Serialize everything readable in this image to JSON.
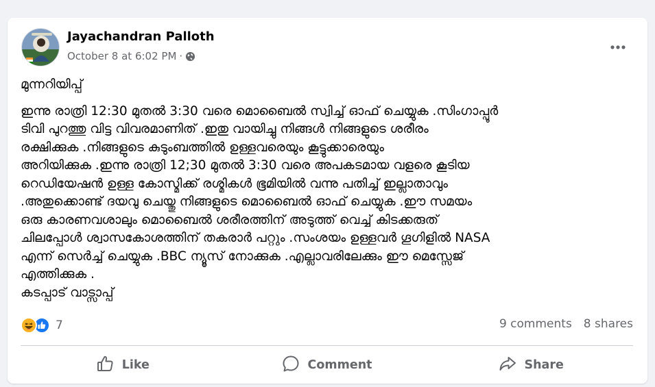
{
  "post": {
    "author": "Jayachandran Palloth",
    "timestamp": "October 8 at 6:02 PM",
    "separator": "·",
    "audience_icon": "globe-icon",
    "more_icon": "more-options-icon",
    "title": "മുന്നറിയിപ്പ്",
    "body_lines": [
      "ഇന്നു രാത്രി 12:30 മുതൽ 3:30 വരെ മൊബൈൽ സ്വിച്ച് ഓഫ് ചെയ്യുക .സിംഗാപ്പൂർ",
      "ടിവി പുറത്തു വിട്ട വിവരമാണിത് .ഇതു വായിച്ചു നിങ്ങൾ നിങ്ങളുടെ ശരീരം",
      "രക്ഷിക്കുക .നിങ്ങളുടെ കുടുംബത്തിൽ ഉള്ളവരെയും കൂട്ടുക്കാരെയും",
      "അറിയിക്കുക .ഇന്നു രാത്രി 12;30 മുതൽ 3:30 വരെ അപകടമായ വളരെ കൂടിയ",
      "റെഡിയേഷൻ ഉള്ള കോസ്മിക്ക് രശ്മികൾ ഭൂമിയിൽ വന്നു പതിച്ച് ഇല്ലാതാവും",
      ".അതുക്കൊണ്ട് ദയവു ചെയ്തു നിങ്ങളുടെ മൊബൈൽ ഓഫ് ചെയ്യുക .ഈ സമയം",
      "ഒരു കാരണവശാലും മൊബൈൽ ശരീരത്തിന് അടുത്ത് വെച്ച് കിടക്കരുത്",
      "ചിലപ്പോൾ ശ്വാസകോശത്തിന് തകരാർ പറ്റും .സംശയം ഉള്ളവർ ഗൂഗിളിൽ NASA",
      "എന്ന് സെർച്ച് ചെയ്യുക .BBC ന്യൂസ് നോക്കുക .എല്ലാവരിലേക്കും ഈ മെസ്സേജ്",
      "എത്തിക്കുക .",
      "കടപ്പാട് വാട്സാപ്പ്"
    ]
  },
  "stats": {
    "reaction_icons": [
      "haha-reaction-icon",
      "like-reaction-icon"
    ],
    "reaction_count": "7",
    "comments": "9 comments",
    "shares": "8 shares"
  },
  "actions": {
    "like": "Like",
    "comment": "Comment",
    "share": "Share"
  },
  "colors": {
    "background": "#f0f2f5",
    "card": "#ffffff",
    "secondary_text": "#65676b",
    "like_blue": "#1877f2",
    "haha_yellow": "#f7b125"
  }
}
